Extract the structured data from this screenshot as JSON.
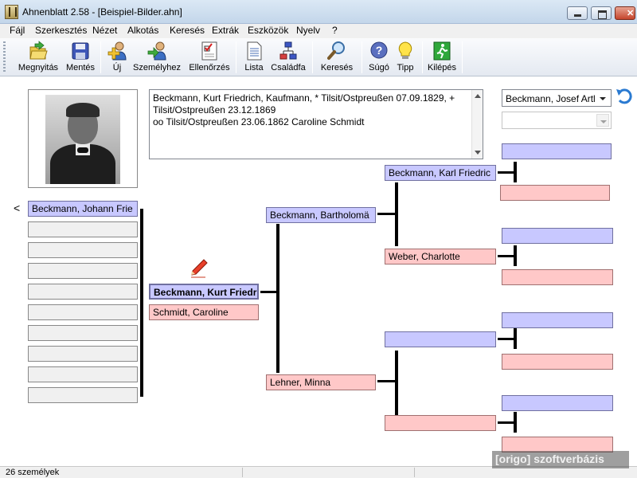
{
  "window": {
    "title": "Ahnenblatt 2.58 - [Beispiel-Bilder.ahn]"
  },
  "menu": {
    "items": [
      "Fájl",
      "Szerkesztés",
      "Nézet",
      "Alkotás",
      "Keresés",
      "Extrák",
      "Eszközök",
      "Nyelv",
      "?"
    ]
  },
  "toolbar": {
    "buttons": [
      {
        "label": "Megnyitás",
        "icon": "open-folder-icon"
      },
      {
        "label": "Mentés",
        "icon": "save-disk-icon"
      },
      {
        "label": "Új",
        "icon": "new-person-icon"
      },
      {
        "label": "Személyhez",
        "icon": "go-to-person-icon"
      },
      {
        "label": "Ellenőrzés",
        "icon": "checklist-icon"
      },
      {
        "label": "Lista",
        "icon": "list-icon"
      },
      {
        "label": "Családfa",
        "icon": "family-tree-icon"
      },
      {
        "label": "Keresés",
        "icon": "magnifier-icon"
      },
      {
        "label": "Súgó",
        "icon": "help-icon"
      },
      {
        "label": "Tipp",
        "icon": "lightbulb-icon"
      },
      {
        "label": "Kilépés",
        "icon": "exit-icon"
      }
    ]
  },
  "info": {
    "text": "Beckmann, Kurt Friedrich, Kaufmann, * Tilsit/Ostpreußen 07.09.1829, + Tilsit/Ostpreußen 23.12.1869\noo Tilsit/Ostpreußen 23.06.1862 Caroline Schmidt"
  },
  "selectors": {
    "person": "Beckmann, Josef Artl",
    "second": ""
  },
  "children": {
    "marker": "<",
    "items": [
      "Beckmann, Johann Frie",
      "",
      "",
      "",
      "",
      "",
      "",
      "",
      "",
      ""
    ]
  },
  "tree": {
    "person": "Beckmann, Kurt Friedri",
    "spouse": "Schmidt, Caroline",
    "father": "Beckmann, Bartholomä",
    "mother": "Lehner, Minna",
    "paternal_grandfather": "Beckmann, Karl  Friedric",
    "paternal_grandmother": "Weber, Charlotte",
    "maternal_grandfather": "",
    "maternal_grandmother": "",
    "great_grandparents": [
      "",
      "",
      "",
      "",
      "",
      "",
      "",
      ""
    ]
  },
  "status": {
    "count": "26 személyek"
  },
  "watermark": {
    "text": "[origo] szoftverbázis"
  },
  "colors": {
    "male": "#c8c8ff",
    "female": "#ffc8c8",
    "empty": "#f0f0f0"
  }
}
